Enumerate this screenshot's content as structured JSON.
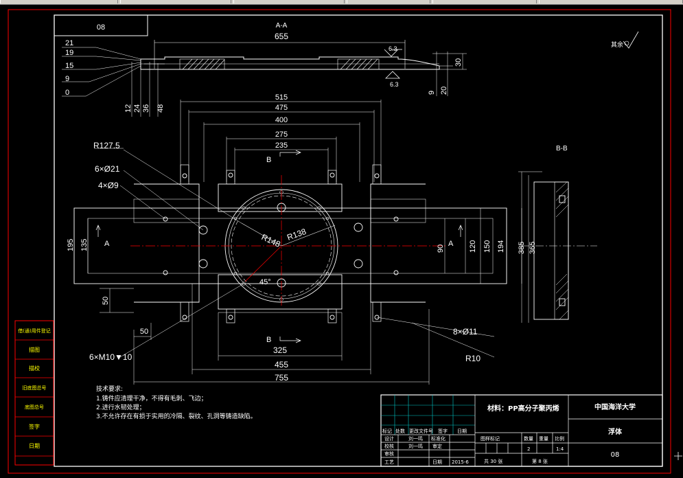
{
  "drawing_number": "08",
  "section_aa_label": "A-A",
  "section_bb_label": "B-B",
  "roughness": {
    "rest_label": "其余",
    "upper_value": "6.3",
    "lower_value": "6.3"
  },
  "dims_top": {
    "d655": "655",
    "d515": "515",
    "d475": "475",
    "d400": "400",
    "d275": "275",
    "d235": "235",
    "left_stack": [
      "21",
      "19",
      "15",
      "9",
      "0"
    ],
    "bottom_stack": [
      "12",
      "24",
      "36",
      "48"
    ],
    "d30": "30",
    "d9": "9",
    "d20": "20"
  },
  "dims_plan": {
    "r1275": "R127.5",
    "holes21": "6×Ø21",
    "holes9": "4×Ø9",
    "r148": "R148",
    "r138": "R138",
    "angle": "45°",
    "d195": "195",
    "d135": "135",
    "d90": "90",
    "d120": "120",
    "d150": "150",
    "d194": "194",
    "d50v": "50",
    "d50h": "50",
    "d325": "325",
    "d455": "455",
    "d755": "755",
    "holes11": "8×Ø11",
    "r10": "R10",
    "thread": "6×M10▼10",
    "cut_a": "A",
    "cut_b": "B"
  },
  "dims_side": {
    "d385": "385",
    "d365": "365"
  },
  "tech_requirements": {
    "title": "技术要求:",
    "items": [
      "1.铸件应清理干净，不得有毛刺、飞边；",
      "2.进行水韧处理；",
      "3.不允许存在有损于实用的冷隔、裂纹、孔洞等铸造缺陷。"
    ]
  },
  "left_stamps": [
    "借(通)用件登记",
    "描图",
    "描校",
    "旧底图总号",
    "底图总号",
    "签字",
    "日期"
  ],
  "title_block": {
    "material": "材料：PP高分子聚丙烯",
    "university": "中国海洋大学",
    "part_name": "浮体",
    "drawing_no": "08",
    "rev_headers": [
      "标记",
      "处数",
      "更改文件号",
      "签字",
      "日期"
    ],
    "rows": [
      {
        "label": "设计",
        "name": "刘一鸣",
        "extra": "标准化"
      },
      {
        "label": "校核",
        "name": "刘一鸣",
        "extra": "审定"
      },
      {
        "label": "审核",
        "name": "",
        "extra": ""
      },
      {
        "label": "工艺",
        "name": "",
        "extra": "日期"
      }
    ],
    "date": "2015-6",
    "mark_headers": [
      "图样标记",
      "数量",
      "重量",
      "比例"
    ],
    "qty": "2",
    "scale": "1:4",
    "total_sheets": "共 30 张",
    "sheet_no": "第 8 张"
  }
}
